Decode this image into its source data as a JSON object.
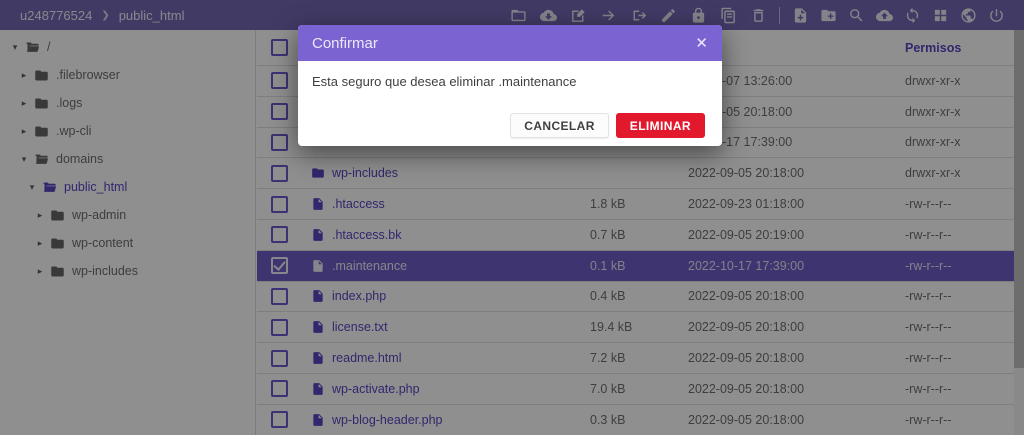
{
  "topbar": {
    "breadcrumb": {
      "account": "u248776524",
      "separator": "❯",
      "location": "public_html"
    },
    "toolbar_primary": [
      "folder-open-icon",
      "download-icon",
      "rename-icon",
      "move-icon",
      "copy-icon",
      "edit-icon",
      "lock-icon",
      "archive-icon",
      "trash-icon"
    ],
    "toolbar_secondary": [
      "file-plus-icon",
      "folder-plus-icon",
      "search-icon",
      "upload-icon",
      "refresh-icon",
      "grid-icon",
      "globe-icon",
      "power-icon"
    ]
  },
  "sidebar": {
    "tree": [
      {
        "label": "/",
        "level": 0,
        "expanded": true,
        "folder": "open",
        "active": false
      },
      {
        "label": ".filebrowser",
        "level": 1,
        "expanded": false,
        "folder": "closed",
        "active": false
      },
      {
        "label": ".logs",
        "level": 1,
        "expanded": false,
        "folder": "closed",
        "active": false
      },
      {
        "label": ".wp-cli",
        "level": 1,
        "expanded": false,
        "folder": "closed",
        "active": false
      },
      {
        "label": "domains",
        "level": 1,
        "expanded": true,
        "folder": "open",
        "active": false
      },
      {
        "label": "public_html",
        "level": 2,
        "expanded": true,
        "folder": "open",
        "active": true
      },
      {
        "label": "wp-admin",
        "level": 3,
        "expanded": false,
        "folder": "closed",
        "active": false
      },
      {
        "label": "wp-content",
        "level": 3,
        "expanded": false,
        "folder": "closed",
        "active": false
      },
      {
        "label": "wp-includes",
        "level": 3,
        "expanded": false,
        "folder": "closed",
        "active": false
      }
    ]
  },
  "table": {
    "header": {
      "permissions_label": "Permisos"
    },
    "rows": [
      {
        "name": "",
        "type": "folder",
        "size": "",
        "date": "-07 13:26:00",
        "permissions": "drwxr-xr-x",
        "checked": false,
        "selected": false,
        "date_clipped": true
      },
      {
        "name": "",
        "type": "folder",
        "size": "",
        "date": "-05 20:18:00",
        "permissions": "drwxr-xr-x",
        "checked": false,
        "selected": false,
        "date_clipped": true
      },
      {
        "name": "",
        "type": "folder",
        "size": "",
        "date": "-17 17:39:00",
        "permissions": "drwxr-xr-x",
        "checked": false,
        "selected": false,
        "date_clipped": true
      },
      {
        "name": "wp-includes",
        "type": "folder",
        "size": "",
        "date": "2022-09-05 20:18:00",
        "permissions": "drwxr-xr-x",
        "checked": false,
        "selected": false,
        "date_clipped": false
      },
      {
        "name": ".htaccess",
        "type": "file",
        "size": "1.8 kB",
        "date": "2022-09-23 01:18:00",
        "permissions": "-rw-r--r--",
        "checked": false,
        "selected": false,
        "date_clipped": false
      },
      {
        "name": ".htaccess.bk",
        "type": "file",
        "size": "0.7 kB",
        "date": "2022-09-05 20:19:00",
        "permissions": "-rw-r--r--",
        "checked": false,
        "selected": false,
        "date_clipped": false
      },
      {
        "name": ".maintenance",
        "type": "file",
        "size": "0.1 kB",
        "date": "2022-10-17 17:39:00",
        "permissions": "-rw-r--r--",
        "checked": true,
        "selected": true,
        "date_clipped": false
      },
      {
        "name": "index.php",
        "type": "file",
        "size": "0.4 kB",
        "date": "2022-09-05 20:18:00",
        "permissions": "-rw-r--r--",
        "checked": false,
        "selected": false,
        "date_clipped": false
      },
      {
        "name": "license.txt",
        "type": "file",
        "size": "19.4 kB",
        "date": "2022-09-05 20:18:00",
        "permissions": "-rw-r--r--",
        "checked": false,
        "selected": false,
        "date_clipped": false
      },
      {
        "name": "readme.html",
        "type": "file",
        "size": "7.2 kB",
        "date": "2022-09-05 20:18:00",
        "permissions": "-rw-r--r--",
        "checked": false,
        "selected": false,
        "date_clipped": false
      },
      {
        "name": "wp-activate.php",
        "type": "file",
        "size": "7.0 kB",
        "date": "2022-09-05 20:18:00",
        "permissions": "-rw-r--r--",
        "checked": false,
        "selected": false,
        "date_clipped": false
      },
      {
        "name": "wp-blog-header.php",
        "type": "file",
        "size": "0.3 kB",
        "date": "2022-09-05 20:18:00",
        "permissions": "-rw-r--r--",
        "checked": false,
        "selected": false,
        "date_clipped": false
      }
    ]
  },
  "modal": {
    "title": "Confirmar",
    "close_glyph": "✕",
    "message": "Esta seguro que desea eliminar .maintenance",
    "cancel_label": "CANCELAR",
    "confirm_label": "ELIMINAR"
  },
  "colors": {
    "primary_purple": "#5747c2",
    "topbar_purple": "#7568b4",
    "modal_header_purple": "#7b64d1",
    "selected_row_purple": "#6f5fc8",
    "danger_red": "#e2182d"
  },
  "glyphs": {
    "chevron_expanded": "▾",
    "chevron_collapsed": "▸"
  }
}
